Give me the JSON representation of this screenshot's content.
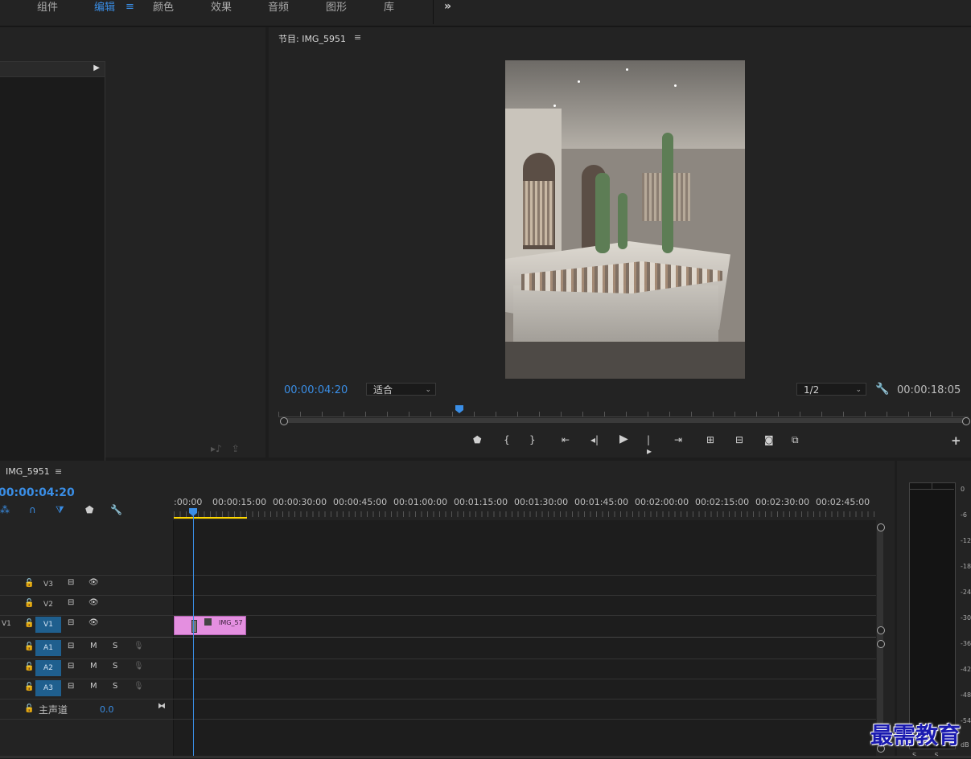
{
  "workspace": {
    "tabs": [
      "组件",
      "编辑",
      "颜色",
      "效果",
      "音频",
      "图形",
      "库"
    ],
    "active_tab": "编辑",
    "menu_glyph": "≡",
    "more_glyph": "»"
  },
  "program_monitor": {
    "title": "节目: IMG_5951",
    "menu_glyph": "≡",
    "current_timecode": "00:00:04:20",
    "zoom": "适合",
    "resolution": "1/2",
    "duration": "00:00:18:05"
  },
  "timeline": {
    "sequence_title": "IMG_5951",
    "menu_glyph": "≡",
    "timecode": "00:00:04:20",
    "ruler_labels": [
      ":00:00",
      "00:00:15:00",
      "00:00:30:00",
      "00:00:45:00",
      "00:01:00:00",
      "00:01:15:00",
      "00:01:30:00",
      "00:01:45:00",
      "00:02:00:00",
      "00:02:15:00",
      "00:02:30:00",
      "00:02:45:00"
    ],
    "video_tracks": [
      "V3",
      "V2",
      "V1"
    ],
    "source_patch_label": "V1",
    "audio_tracks": [
      "A1",
      "A2",
      "A3"
    ],
    "mute_label": "M",
    "solo_label": "S",
    "master": {
      "label": "主声道",
      "value": "0.0"
    },
    "clip": {
      "name": "IMG_57"
    }
  },
  "audio_meter": {
    "db_labels": [
      "0",
      "-6",
      "-12",
      "-18",
      "-24",
      "-30",
      "-36",
      "-42",
      "-48",
      "-54"
    ],
    "unit": "dB",
    "solo_labels": [
      "S",
      "S"
    ]
  },
  "watermark": "最需教育",
  "colors": {
    "accent": "#3a8ee6",
    "clip": "#e48fe0",
    "work_area": "#ffd800",
    "panel": "#232323"
  }
}
